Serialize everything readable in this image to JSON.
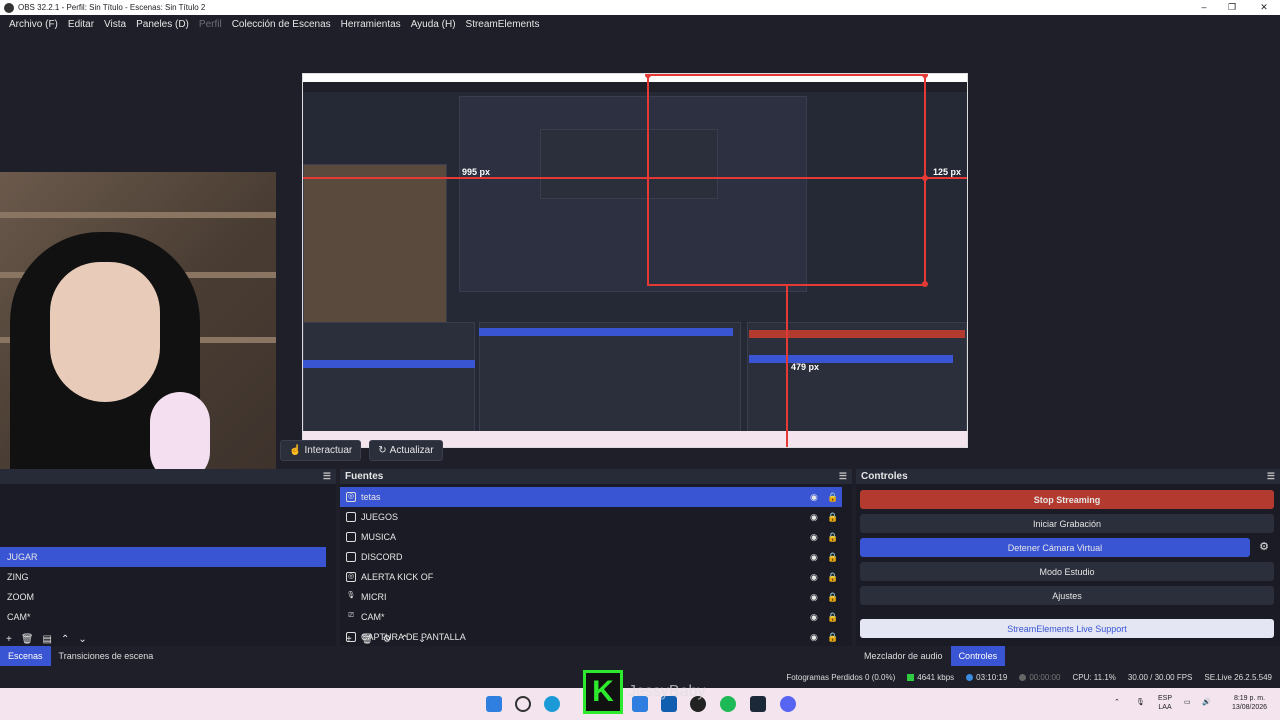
{
  "window": {
    "title": "OBS 32.2.1 - Perfil: Sin Título - Escenas: Sin Título 2",
    "minimize": "–",
    "maximize": "❐",
    "close": "✕"
  },
  "menu": [
    "Archivo (F)",
    "Editar",
    "Vista",
    "Paneles (D)",
    "Perfil",
    "Colección de Escenas",
    "Herramientas",
    "Ayuda (H)",
    "StreamElements"
  ],
  "preview": {
    "labels": {
      "width_label": "995 px",
      "right_label": "125 px",
      "bottom_label": "479 px"
    },
    "colors": {
      "guide": "#e53935",
      "bg": "#252835"
    }
  },
  "toolbar": {
    "interact_label": "Interactuar",
    "refresh_label": "Actualizar"
  },
  "scenes": {
    "items": [
      "JUGAR",
      "ZING",
      "ZOOM",
      "CAM*"
    ],
    "selected": "JUGAR",
    "tab_scenes": "Escenas",
    "tab_transitions": "Transiciones de escena"
  },
  "sources": {
    "title": "Fuentes",
    "items": [
      {
        "name": "tetas",
        "icon": "globe-icon"
      },
      {
        "name": "JUEGOS",
        "icon": "window-icon"
      },
      {
        "name": "MUSICA",
        "icon": "window-icon"
      },
      {
        "name": "DISCORD",
        "icon": "window-icon"
      },
      {
        "name": "ALERTA KICK OF",
        "icon": "globe-icon"
      },
      {
        "name": "MICRI",
        "icon": "mic-icon"
      },
      {
        "name": "CAM*",
        "icon": "camera-icon"
      },
      {
        "name": "CAPTURA DE PANTALLA",
        "icon": "monitor-icon"
      }
    ]
  },
  "controls": {
    "title": "Controles",
    "stop_streaming": "Stop Streaming",
    "start_recording": "Iniciar Grabación",
    "stop_vcam": "Detener Cámara Virtual",
    "studio_mode": "Modo Estudio",
    "settings": "Ajustes",
    "se_support": "StreamElements Live Support",
    "tab_mixer": "Mezclador de audio",
    "tab_controls": "Controles"
  },
  "status": {
    "dropped": "Fotogramas Perdidos 0 (0.0%)",
    "bitrate": "4641 kbps",
    "stream_time": "03:10:19",
    "rec_time": "00:00:00",
    "cpu": "CPU: 11.1%",
    "fps": "30.00 / 30.00 FPS",
    "se_version": "SE.Live 26.2.5.549"
  },
  "taskbar": {
    "lang": "ESP",
    "lang2": "LAA",
    "time": "8:19 p. m.",
    "date": "13/08/2026",
    "overlay_letter": "K",
    "overlay_name": "JessyBaby"
  },
  "colors": {
    "accent": "#3a55d4",
    "stop": "#b23a2e",
    "bg": "#1e1f29"
  }
}
